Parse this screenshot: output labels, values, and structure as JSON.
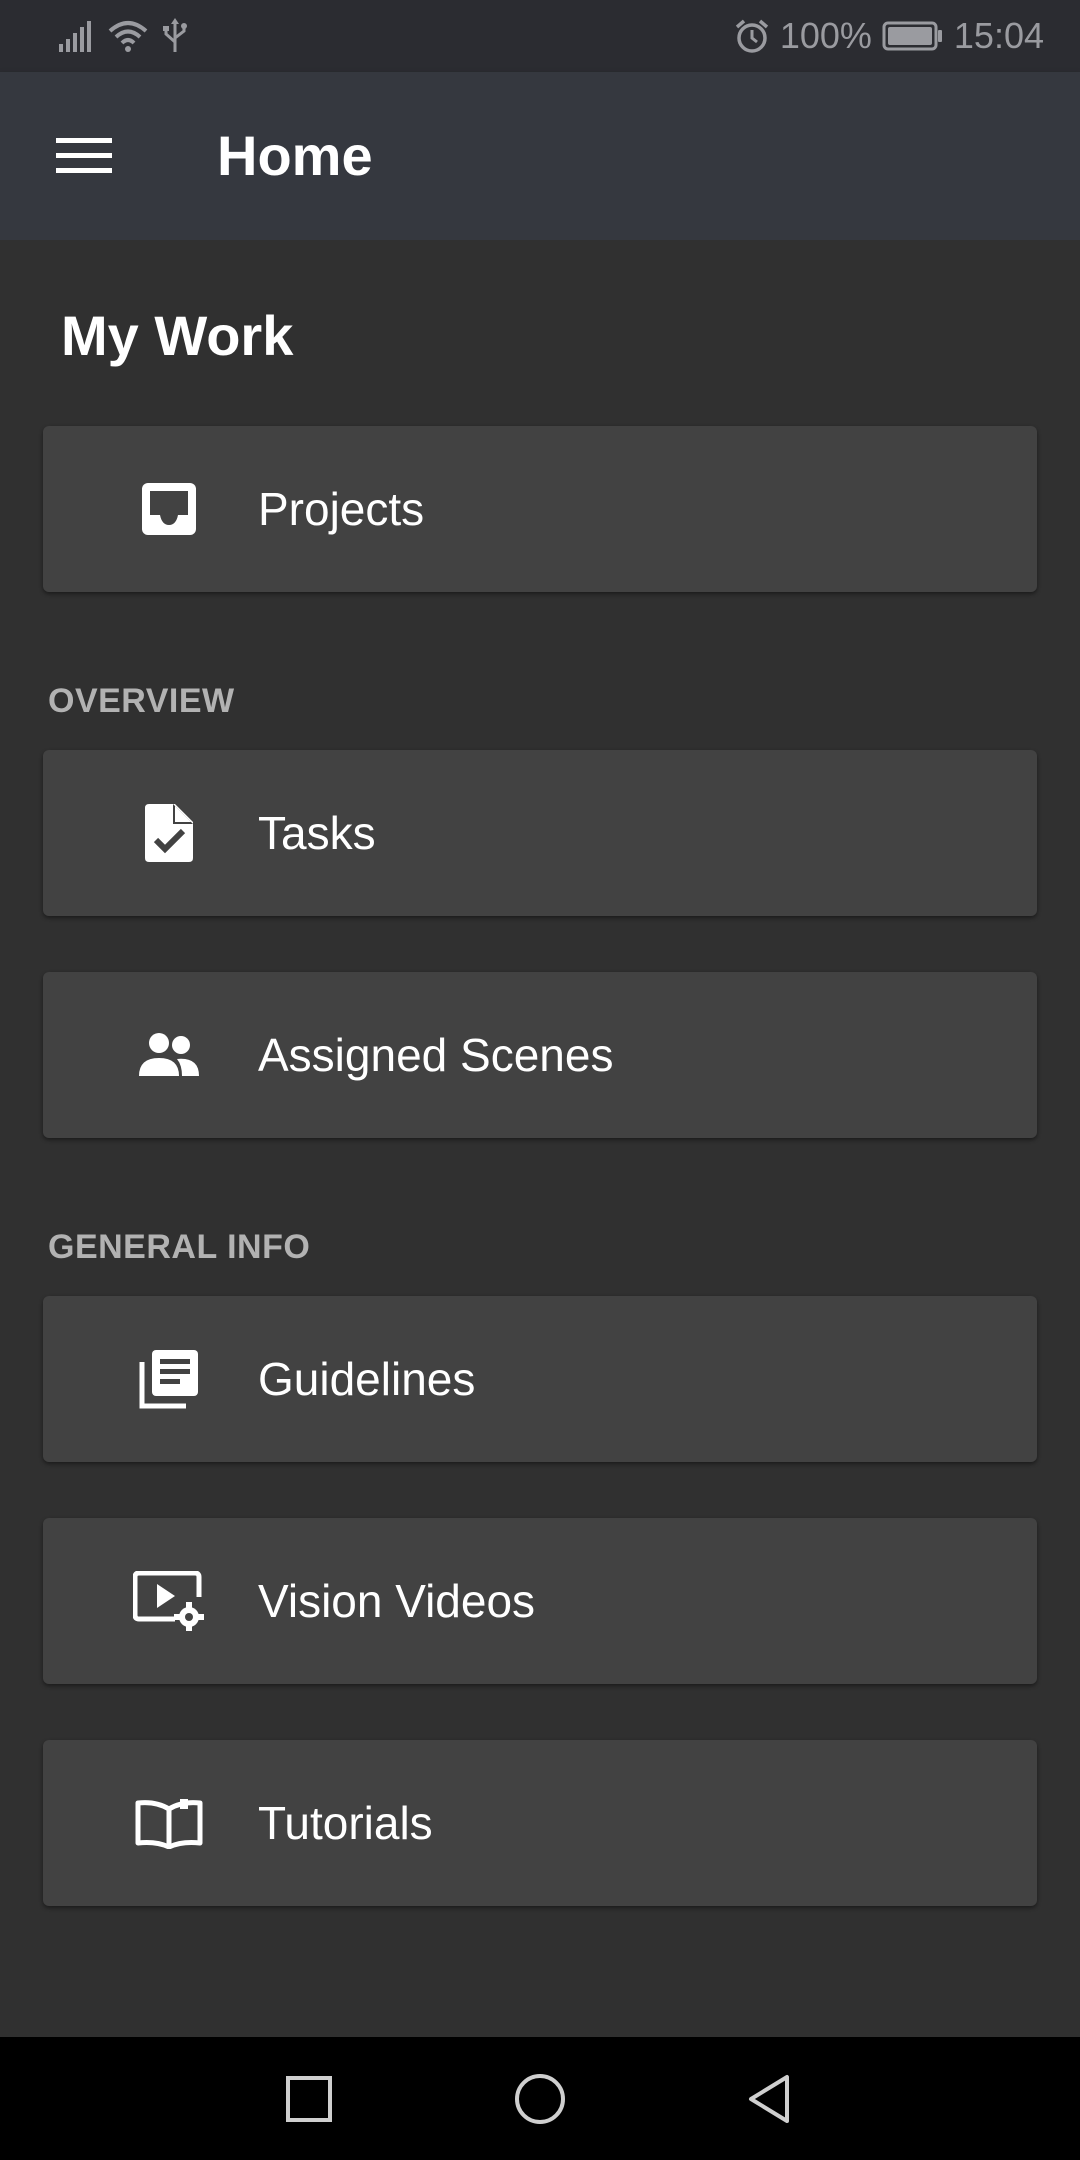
{
  "status_bar": {
    "battery_percent": "100%",
    "time": "15:04",
    "icons": [
      "signal-icon",
      "wifi-icon",
      "usb-icon",
      "alarm-icon",
      "battery-icon"
    ]
  },
  "app_bar": {
    "title": "Home",
    "menu_icon": "menu-icon"
  },
  "main": {
    "title": "My Work",
    "items": [
      {
        "label": "Projects",
        "icon": "inbox-icon"
      }
    ],
    "sections": [
      {
        "header": "OVERVIEW",
        "items": [
          {
            "label": "Tasks",
            "icon": "task-file-icon"
          },
          {
            "label": "Assigned Scenes",
            "icon": "people-icon"
          }
        ]
      },
      {
        "header": "GENERAL INFO",
        "items": [
          {
            "label": "Guidelines",
            "icon": "library-books-icon"
          },
          {
            "label": "Vision Videos",
            "icon": "video-settings-icon"
          },
          {
            "label": "Tutorials",
            "icon": "open-book-icon"
          }
        ]
      }
    ]
  },
  "nav_bar": {
    "buttons": [
      "recent-apps-icon",
      "home-icon",
      "back-icon"
    ]
  },
  "colors": {
    "background": "#303030",
    "app_bar": "#35383f",
    "card": "#424242",
    "section_header": "#b2b2b2",
    "text": "#ffffff"
  }
}
